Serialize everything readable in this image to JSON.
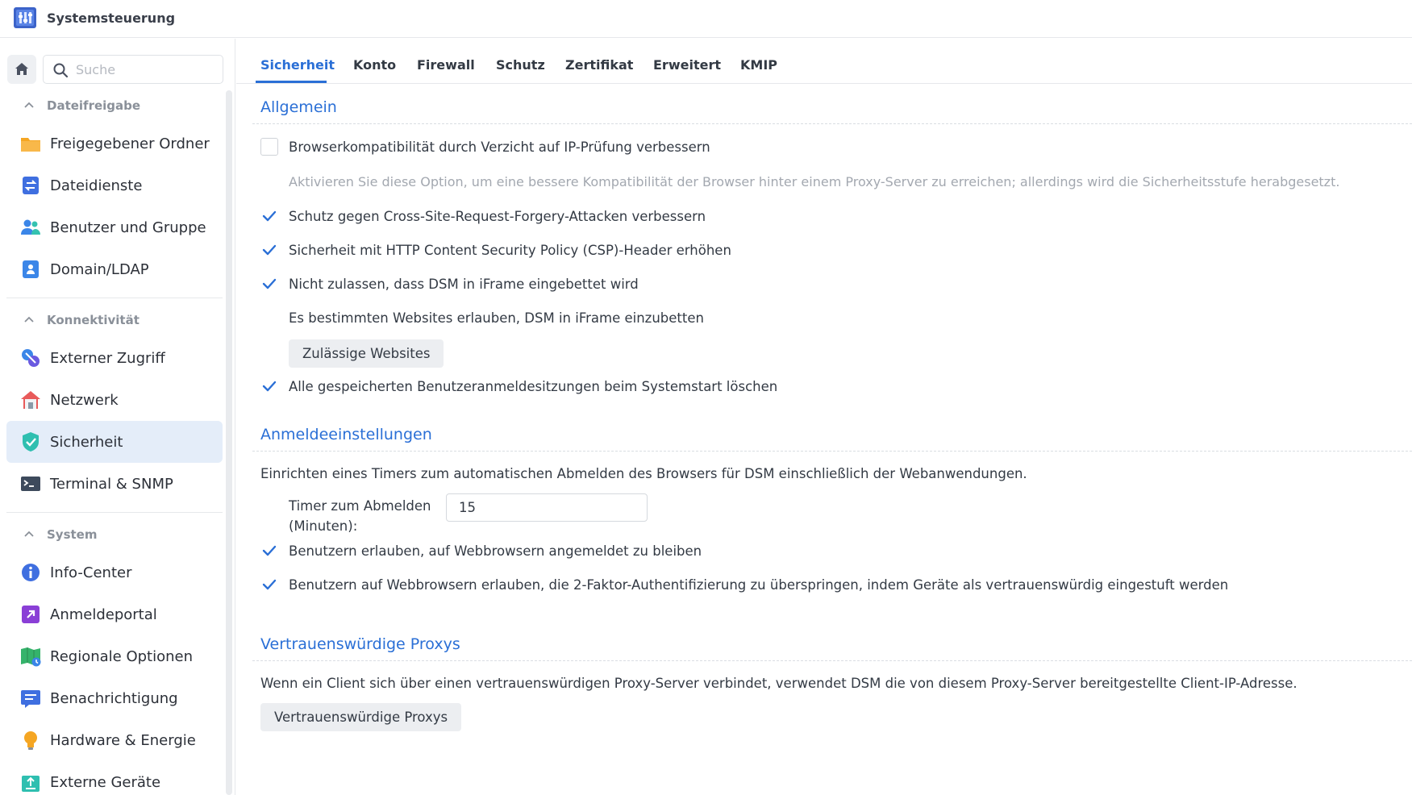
{
  "window": {
    "title": "Systemsteuerung"
  },
  "search": {
    "placeholder": "Suche"
  },
  "sidebar": {
    "groups": [
      {
        "label": "Dateifreigabe",
        "items": [
          "Freigegebener Ordner",
          "Dateidienste",
          "Benutzer und Gruppe",
          "Domain/LDAP"
        ]
      },
      {
        "label": "Konnektivität",
        "items": [
          "Externer Zugriff",
          "Netzwerk",
          "Sicherheit",
          "Terminal & SNMP"
        ]
      },
      {
        "label": "System",
        "items": [
          "Info-Center",
          "Anmeldeportal",
          "Regionale Optionen",
          "Benachrichtigung",
          "Hardware & Energie",
          "Externe Geräte"
        ]
      }
    ],
    "active_item": "Sicherheit"
  },
  "tabs": [
    "Sicherheit",
    "Konto",
    "Firewall",
    "Schutz",
    "Zertifikat",
    "Erweitert",
    "KMIP"
  ],
  "active_tab": "Sicherheit",
  "accent_color": "#2a6fd6",
  "general": {
    "title": "Allgemein",
    "browser_compat": {
      "label": "Browserkompatibilität durch Verzicht auf IP-Prüfung verbessern",
      "checked": false
    },
    "browser_compat_hint": "Aktivieren Sie diese Option, um eine bessere Kompatibilität der Browser hinter einem Proxy-Server zu erreichen; allerdings wird die Sicherheitsstufe herabgesetzt.",
    "csrf": {
      "label": "Schutz gegen Cross-Site-Request-Forgery-Attacken verbessern",
      "checked": true
    },
    "csp": {
      "label": "Sicherheit mit HTTP Content Security Policy (CSP)-Header erhöhen",
      "checked": true
    },
    "iframe": {
      "label": "Nicht zulassen, dass DSM in iFrame eingebettet wird",
      "checked": true
    },
    "iframe_allow_text": "Es bestimmten Websites erlauben, DSM in iFrame einzubetten",
    "allowed_sites_button": "Zulässige Websites",
    "clear_sessions": {
      "label": "Alle gespeicherten Benutzeranmeldesitzungen beim Systemstart löschen",
      "checked": true
    }
  },
  "login": {
    "title": "Anmeldeeinstellungen",
    "description": "Einrichten eines Timers zum automatischen Abmelden des Browsers für DSM einschließlich der Webanwendungen.",
    "timer_label_1": "Timer zum Abmelden",
    "timer_label_2": "(Minuten):",
    "timer_value": "15",
    "stay_logged_in": {
      "label": "Benutzern erlauben, auf Webbrowsern angemeldet zu bleiben",
      "checked": true
    },
    "skip_2fa": {
      "label": "Benutzern auf Webbrowsern erlauben, die 2-Faktor-Authentifizierung zu überspringen, indem Geräte als vertrauenswürdig eingestuft werden",
      "checked": true
    }
  },
  "proxies": {
    "title": "Vertrauenswürdige Proxys",
    "description": "Wenn ein Client sich über einen vertrauenswürdigen Proxy-Server verbindet, verwendet DSM die von diesem Proxy-Server bereitgestellte Client-IP-Adresse.",
    "button": "Vertrauenswürdige Proxys"
  }
}
